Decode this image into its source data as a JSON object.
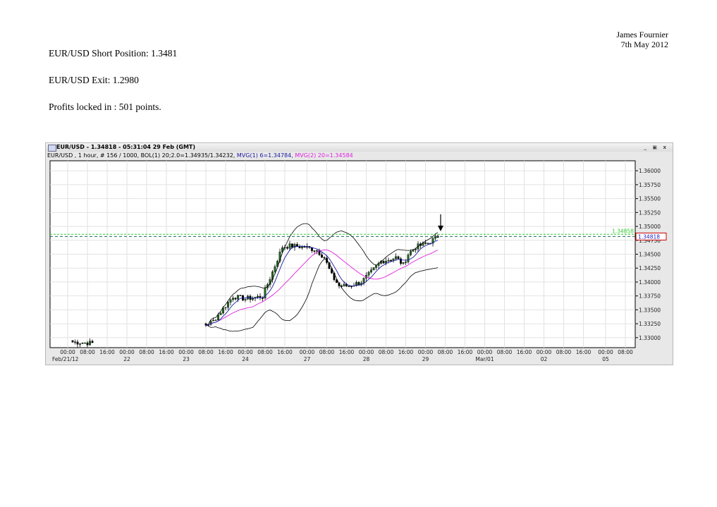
{
  "header": {
    "author": "James Fournier",
    "date": "7th May 2012"
  },
  "lines": [
    "EUR/USD Short Position: 1.3481",
    "EUR/USD Exit: 1.2980",
    "Profits locked in : 501 points."
  ],
  "window": {
    "title": "EUR/USD - 1.34818 - 05:31:04 29 Feb (GMT)",
    "buttons": "_ ▣ x",
    "info": {
      "base": "EUR/USD , 1 hour, # 156 / 1000, BOL(1) 20;2.0=1.34935/1.34232,",
      "mvg1": "MVG(1) 6=1.34784,",
      "mvg2": "MVG(2) 20=1.34584"
    }
  },
  "colors": {
    "up": "#1f6b1f",
    "down": "#000000",
    "mvg1": "#1a1aa0",
    "mvg2": "#e020e0",
    "boll": "#000000",
    "green_line": "#33cc33",
    "dash_line": "#226666",
    "price_box": "#cc0000"
  },
  "chart_data": {
    "type": "candlestick",
    "title": "EUR/USD - 1 hour",
    "ylim": [
      1.3282,
      1.3618
    ],
    "yticks": [
      "1.36000",
      "1.35750",
      "1.35500",
      "1.35250",
      "1.35000",
      "1.34750",
      "1.34500",
      "1.34250",
      "1.34000",
      "1.33750",
      "1.33500",
      "1.33250",
      "1.33000"
    ],
    "xticks": [
      {
        "h": 0,
        "t": "00:00",
        "d": "Feb/21/12"
      },
      {
        "h": 8,
        "t": "08:00"
      },
      {
        "h": 16,
        "t": "16:00"
      },
      {
        "h": 24,
        "t": "00:00",
        "d": "22"
      },
      {
        "h": 32,
        "t": "08:00"
      },
      {
        "h": 40,
        "t": "16:00"
      },
      {
        "h": 48,
        "t": "00:00",
        "d": "23"
      },
      {
        "h": 56,
        "t": "08:00"
      },
      {
        "h": 64,
        "t": "16:00"
      },
      {
        "h": 72,
        "t": "00:00",
        "d": "24"
      },
      {
        "h": 80,
        "t": "08:00"
      },
      {
        "h": 88,
        "t": "16:00"
      },
      {
        "h": 97,
        "t": "00:00",
        "d": "27"
      },
      {
        "h": 105,
        "t": "08:00"
      },
      {
        "h": 113,
        "t": "16:00"
      },
      {
        "h": 121,
        "t": "00:00",
        "d": "28"
      },
      {
        "h": 129,
        "t": "08:00"
      },
      {
        "h": 137,
        "t": "16:00"
      },
      {
        "h": 145,
        "t": "00:00",
        "d": "29"
      },
      {
        "h": 153,
        "t": "08:00"
      },
      {
        "h": 161,
        "t": "16:00"
      },
      {
        "h": 169,
        "t": "00:00",
        "d": "Mar/01"
      },
      {
        "h": 177,
        "t": "08:00"
      },
      {
        "h": 185,
        "t": "16:00"
      },
      {
        "h": 193,
        "t": "00:00",
        "d": "02"
      },
      {
        "h": 201,
        "t": "08:00"
      },
      {
        "h": 209,
        "t": "16:00"
      },
      {
        "h": 218,
        "t": "00:00",
        "d": "05"
      },
      {
        "h": 226,
        "t": "08:00"
      }
    ],
    "close_keypoints": [
      [
        2,
        1.3292
      ],
      [
        10,
        1.329
      ],
      [
        56,
        1.3323
      ],
      [
        59,
        1.333
      ],
      [
        67,
        1.3374
      ],
      [
        72,
        1.337
      ],
      [
        79,
        1.3374
      ],
      [
        83,
        1.3418
      ],
      [
        87,
        1.3463
      ],
      [
        90,
        1.3465
      ],
      [
        96,
        1.3463
      ],
      [
        101,
        1.3457
      ],
      [
        104,
        1.3444
      ],
      [
        107,
        1.3412
      ],
      [
        110,
        1.3393
      ],
      [
        114,
        1.3393
      ],
      [
        119,
        1.34
      ],
      [
        123,
        1.3418
      ],
      [
        127,
        1.3437
      ],
      [
        133,
        1.3444
      ],
      [
        136,
        1.3431
      ],
      [
        138,
        1.345
      ],
      [
        141,
        1.3463
      ],
      [
        146,
        1.347
      ],
      [
        150,
        1.3482
      ]
    ],
    "hlines": {
      "green": "1.34858",
      "current": "1.34818"
    },
    "units": "x = trading hours since Feb/21/12 00:00"
  }
}
